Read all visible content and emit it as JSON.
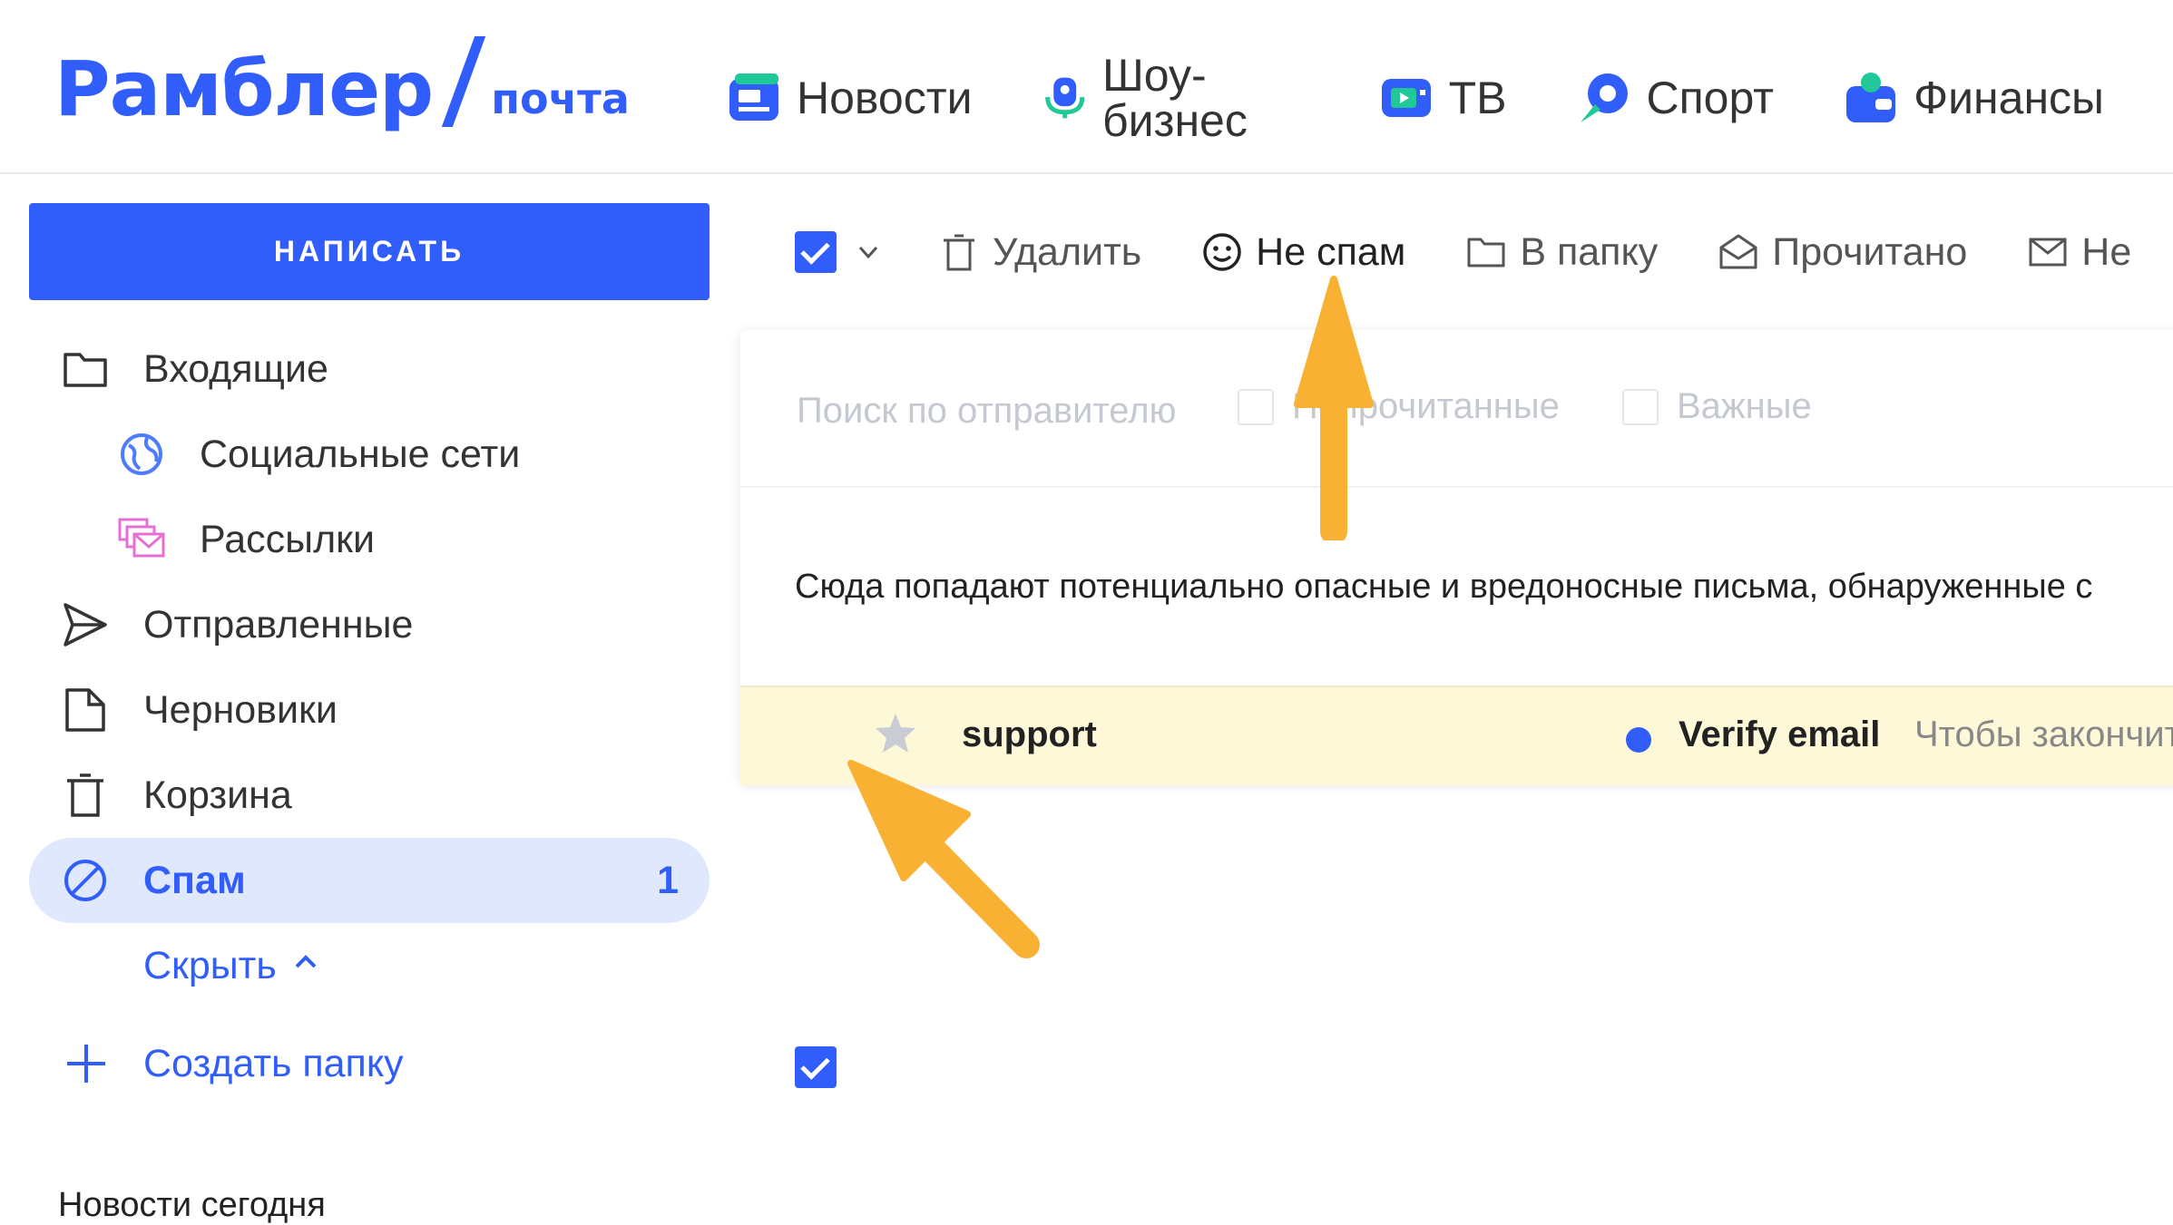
{
  "header": {
    "logo_main": "Рамблер",
    "logo_sub": "почта",
    "nav": [
      {
        "label": "Новости",
        "icon": "news-icon"
      },
      {
        "label": "Шоу-бизнес",
        "icon": "showbiz-icon"
      },
      {
        "label": "ТВ",
        "icon": "tv-icon"
      },
      {
        "label": "Спорт",
        "icon": "sport-icon"
      },
      {
        "label": "Финансы",
        "icon": "finance-icon"
      }
    ]
  },
  "sidebar": {
    "compose_label": "НАПИСАТЬ",
    "folders": [
      {
        "label": "Входящие",
        "icon": "folder-icon"
      },
      {
        "label": "Социальные сети",
        "icon": "globe-icon"
      },
      {
        "label": "Рассылки",
        "icon": "newsletter-icon"
      },
      {
        "label": "Отправленные",
        "icon": "send-icon"
      },
      {
        "label": "Черновики",
        "icon": "draft-icon"
      },
      {
        "label": "Корзина",
        "icon": "trash-icon"
      },
      {
        "label": "Спам",
        "icon": "spam-icon",
        "count": "1"
      }
    ],
    "hide_label": "Скрыть",
    "create_folder_label": "Создать папку",
    "news_today": "Новости сегодня"
  },
  "toolbar": {
    "delete_label": "Удалить",
    "not_spam_label": "Не спам",
    "to_folder_label": "В папку",
    "read_label": "Прочитано",
    "unread_label": "Не"
  },
  "filters": {
    "search_placeholder": "Поиск по отправителю",
    "unread_label": "Непрочитанные",
    "important_label": "Важные"
  },
  "notice": "Сюда попадают потенциально опасные и вредоносные письма, обнаруженные с",
  "messages": [
    {
      "sender": "support",
      "subject": "Verify email",
      "preview": "Чтобы закончит",
      "checked": true,
      "unread": true
    }
  ],
  "colors": {
    "accent": "#315efb",
    "active_bg": "#dfe8fd",
    "row_highlight": "#fdf8d8",
    "arrow": "#f8b133"
  }
}
